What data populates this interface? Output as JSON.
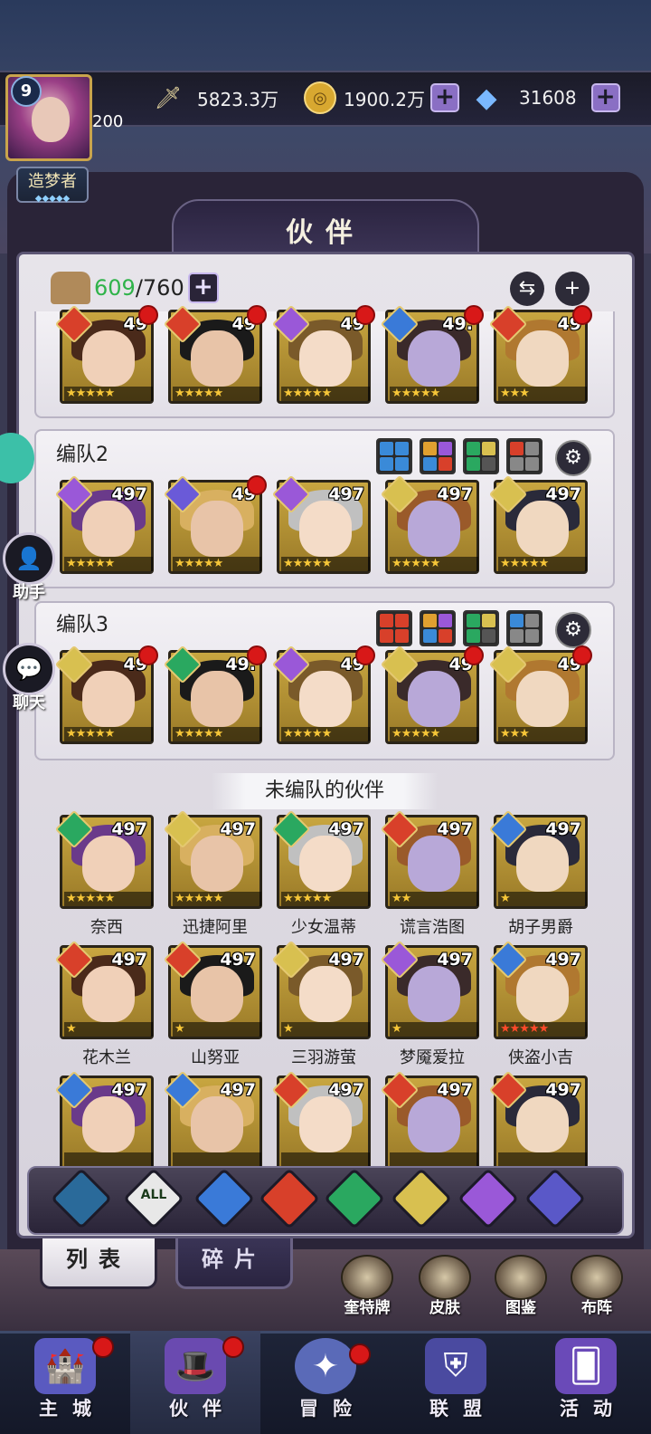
{
  "player": {
    "level": "9",
    "vip_value": "200",
    "title": "造梦者",
    "title_stars": "◆◆◆◆◆"
  },
  "resources": {
    "power": "5823.3万",
    "gold": "1900.2万",
    "gems": "31608",
    "plus_symbol": "+",
    "icons": [
      "sword-icon",
      "gold-coin-icon",
      "diamond-icon"
    ]
  },
  "panel": {
    "title": "伙伴",
    "owned": "609",
    "capacity": "/760",
    "plus_symbol": "+",
    "swap_symbol": "⇆",
    "add_symbol": "+"
  },
  "teams": [
    {
      "label": "",
      "heroes": [
        {
          "level": "49",
          "stars": "★★★★★",
          "elem": "fire",
          "dot": true
        },
        {
          "level": "49",
          "stars": "★★★★★",
          "elem": "fire",
          "dot": true
        },
        {
          "level": "49",
          "stars": "★★★★★",
          "elem": "moon",
          "dot": true
        },
        {
          "level": "49.",
          "stars": "★★★★★",
          "elem": "water",
          "dot": true
        },
        {
          "level": "49",
          "stars": "★★★",
          "elem": "fire",
          "dot": true
        }
      ]
    },
    {
      "label": "编队2",
      "heroes": [
        {
          "level": "497",
          "stars": "★★★★★",
          "elem": "moon",
          "dot": false
        },
        {
          "level": "49",
          "stars": "★★★★★",
          "elem": "void",
          "dot": true
        },
        {
          "level": "497",
          "stars": "★★★★★",
          "elem": "moon",
          "dot": false
        },
        {
          "level": "497",
          "stars": "★★★★★",
          "elem": "light",
          "dot": false
        },
        {
          "level": "497",
          "stars": "★★★★★",
          "elem": "light",
          "dot": false
        }
      ]
    },
    {
      "label": "编队3",
      "heroes": [
        {
          "level": "49",
          "stars": "★★★★★",
          "elem": "light",
          "dot": true
        },
        {
          "level": "49.",
          "stars": "★★★★★",
          "elem": "wind",
          "dot": true
        },
        {
          "level": "49",
          "stars": "★★★★★",
          "elem": "moon",
          "dot": true
        },
        {
          "level": "49",
          "stars": "★★★★★",
          "elem": "light",
          "dot": true
        },
        {
          "level": "49",
          "stars": "★★★",
          "elem": "light",
          "dot": true
        }
      ]
    }
  ],
  "unassigned_title": "未编队的伙伴",
  "unassigned": [
    {
      "name": "奈西",
      "level": "497",
      "stars": "★★★★★",
      "elem": "wind",
      "red_stars": false
    },
    {
      "name": "迅捷阿里",
      "level": "497",
      "stars": "★★★★★",
      "elem": "light",
      "red_stars": false
    },
    {
      "name": "少女温蒂",
      "level": "497",
      "stars": "★★★★★",
      "elem": "wind",
      "red_stars": false
    },
    {
      "name": "谎言浩图",
      "level": "497",
      "stars": "★★",
      "elem": "fire",
      "red_stars": false
    },
    {
      "name": "胡子男爵",
      "level": "497",
      "stars": "★",
      "elem": "water",
      "red_stars": false
    },
    {
      "name": "花木兰",
      "level": "497",
      "stars": "★",
      "elem": "fire",
      "red_stars": false
    },
    {
      "name": "山努亚",
      "level": "497",
      "stars": "★",
      "elem": "fire",
      "red_stars": false
    },
    {
      "name": "三羽游萤",
      "level": "497",
      "stars": "★",
      "elem": "light",
      "red_stars": false
    },
    {
      "name": "梦魇爱拉",
      "level": "497",
      "stars": "★",
      "elem": "moon",
      "red_stars": false
    },
    {
      "name": "侠盗小吉",
      "level": "497",
      "stars": "★★★★★",
      "elem": "water",
      "red_stars": true
    },
    {
      "name": "",
      "level": "497",
      "stars": "",
      "elem": "water",
      "red_stars": false
    },
    {
      "name": "",
      "level": "497",
      "stars": "",
      "elem": "water",
      "red_stars": false
    },
    {
      "name": "",
      "level": "497",
      "stars": "",
      "elem": "fire",
      "red_stars": false
    },
    {
      "name": "",
      "level": "497",
      "stars": "",
      "elem": "fire",
      "red_stars": false
    },
    {
      "name": "",
      "level": "497",
      "stars": "",
      "elem": "fire",
      "red_stars": false
    }
  ],
  "filters": [
    {
      "id": "void-dark",
      "label": ""
    },
    {
      "id": "all",
      "label": "ALL"
    },
    {
      "id": "water",
      "label": ""
    },
    {
      "id": "fire",
      "label": ""
    },
    {
      "id": "wind",
      "label": ""
    },
    {
      "id": "light",
      "label": ""
    },
    {
      "id": "moon",
      "label": ""
    },
    {
      "id": "planet",
      "label": ""
    }
  ],
  "tabs": {
    "list": "列表",
    "shards": "碎片"
  },
  "quick_actions": [
    "奎特牌",
    "皮肤",
    "图鉴",
    "布阵"
  ],
  "side_buttons": {
    "helper": "助手",
    "chat": "聊天"
  },
  "nav": [
    {
      "label": "主城",
      "icon": "castle-icon",
      "dot": true
    },
    {
      "label": "伙伴",
      "icon": "witch-hat-icon",
      "dot": true
    },
    {
      "label": "冒险",
      "icon": "compass-icon",
      "dot": true
    },
    {
      "label": "联盟",
      "icon": "shield-icon",
      "dot": false
    },
    {
      "label": "活动",
      "icon": "cards-icon",
      "dot": false
    }
  ],
  "element_colors": {
    "fire": "#d8402a",
    "water": "#3a7ad8",
    "wind": "#2aa860",
    "light": "#d8c050",
    "moon": "#9a58d8",
    "void": "#6a5ad8",
    "void-dark": "#2a6a9a",
    "all": "#e8e8e8",
    "planet": "#5a58c8"
  }
}
